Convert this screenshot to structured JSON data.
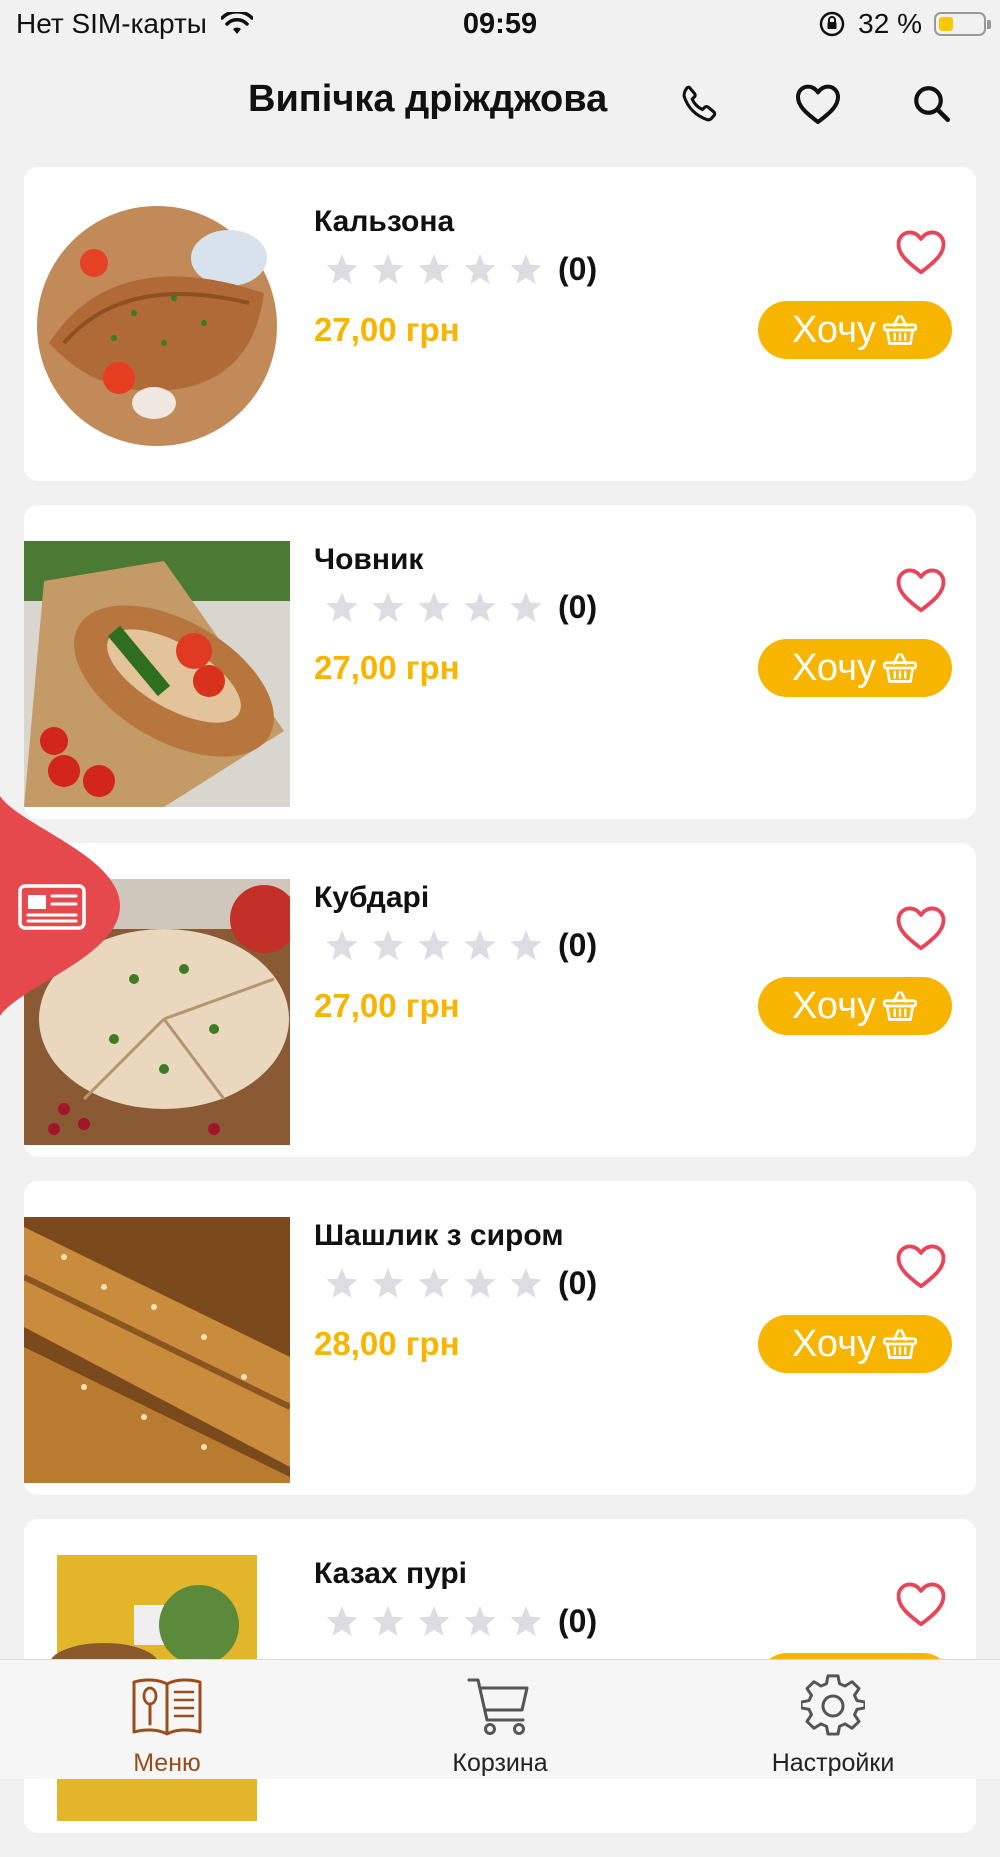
{
  "status_bar": {
    "carrier": "Нет SIM-карты",
    "time": "09:59",
    "battery_text": "32 %",
    "battery_level": 0.32
  },
  "header": {
    "title": "Випічка дріжджова",
    "icons": [
      "phone-icon",
      "heart-icon",
      "search-icon"
    ]
  },
  "products": [
    {
      "name": "Кальзона",
      "rating_count": "(0)",
      "price": "27,00 грн",
      "button": "Хочу",
      "stars": 0
    },
    {
      "name": "Човник",
      "rating_count": "(0)",
      "price": "27,00 грн",
      "button": "Хочу",
      "stars": 0
    },
    {
      "name": "Кубдарі",
      "rating_count": "(0)",
      "price": "27,00 грн",
      "button": "Хочу",
      "stars": 0
    },
    {
      "name": "Шашлик з сиром",
      "rating_count": "(0)",
      "price": "28,00 грн",
      "button": "Хочу",
      "stars": 0
    },
    {
      "name": "Казах пурі",
      "rating_count": "(0)",
      "price": "",
      "button": "Хочу",
      "stars": 0
    }
  ],
  "tabbar": {
    "items": [
      {
        "label": "Меню",
        "icon": "menu-book-icon",
        "active": true
      },
      {
        "label": "Корзина",
        "icon": "cart-icon",
        "active": false
      },
      {
        "label": "Настройки",
        "icon": "gear-icon",
        "active": false
      }
    ]
  },
  "colors": {
    "accent": "#f7b500",
    "heart": "#e8455a",
    "active_tab": "#9a4d1c",
    "side_tab": "#e5484d"
  }
}
